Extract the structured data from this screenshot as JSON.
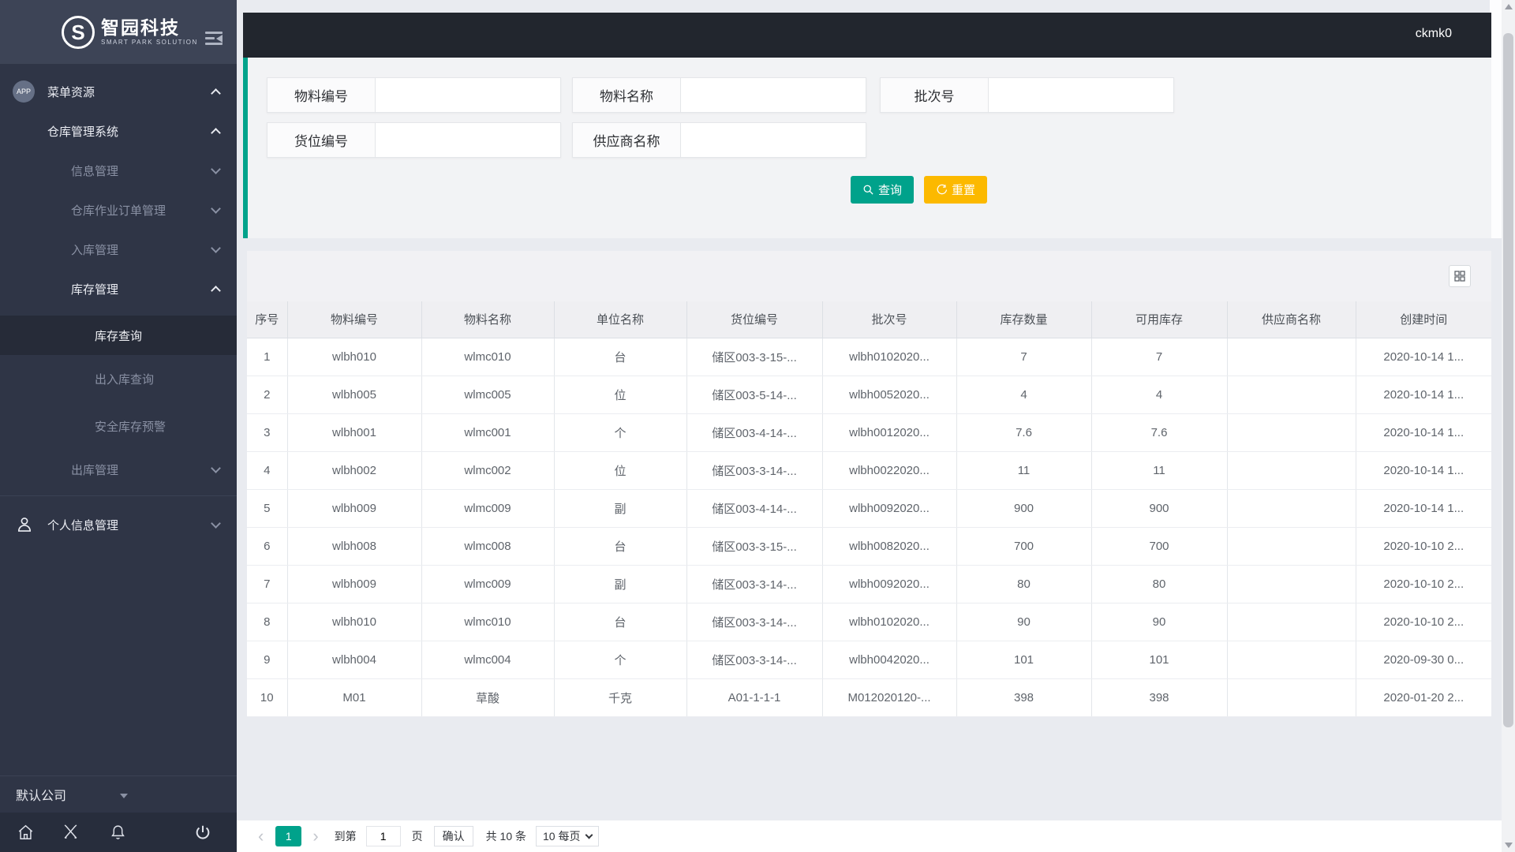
{
  "sidebar": {
    "logo": {
      "icon": "S",
      "title": "智园科技",
      "subtitle": "SMART PARK SOLUTION"
    },
    "menu": [
      {
        "key": "menu-resources",
        "label": "菜单资源",
        "level": 1,
        "tone": "white",
        "chevron": "up",
        "badge": "APP"
      },
      {
        "key": "warehouse-system",
        "label": "仓库管理系统",
        "level": 2,
        "tone": "white",
        "chevron": "up"
      },
      {
        "key": "info-mgmt",
        "label": "信息管理",
        "level": 3,
        "tone": "gray",
        "chevron": "down"
      },
      {
        "key": "warehouse-order-mgmt",
        "label": "仓库作业订单管理",
        "level": 3,
        "tone": "gray",
        "chevron": "down"
      },
      {
        "key": "inbound-mgmt",
        "label": "入库管理",
        "level": 3,
        "tone": "gray",
        "chevron": "down"
      },
      {
        "key": "inventory-mgmt",
        "label": "库存管理",
        "level": 3,
        "tone": "white",
        "chevron": "up"
      },
      {
        "key": "inventory-query",
        "label": "库存查询",
        "level": 4,
        "tone": "white",
        "active": true
      },
      {
        "key": "inout-query",
        "label": "出入库查询",
        "level": 4,
        "tone": "gray"
      },
      {
        "key": "safety-stock-alert",
        "label": "安全库存预警",
        "level": 4,
        "tone": "gray"
      },
      {
        "key": "outbound-mgmt",
        "label": "出库管理",
        "level": 3,
        "tone": "gray",
        "chevron": "down"
      },
      {
        "divider": true
      },
      {
        "key": "personal-info-mgmt",
        "label": "个人信息管理",
        "level": 1,
        "tone": "white",
        "chevron": "down",
        "icon": "user"
      }
    ],
    "company": "默认公司"
  },
  "header": {
    "username": "ckmk0"
  },
  "search": {
    "fields": [
      {
        "key": "material-code",
        "label": "物料编号",
        "value": "",
        "pos": "r1c1"
      },
      {
        "key": "material-name",
        "label": "物料名称",
        "value": "",
        "pos": "r1c2"
      },
      {
        "key": "batch-no",
        "label": "批次号",
        "value": "",
        "pos": "r1c3"
      },
      {
        "key": "location-code",
        "label": "货位编号",
        "value": "",
        "pos": "r2c1"
      },
      {
        "key": "supplier-name",
        "label": "供应商名称",
        "value": "",
        "pos": "r2c2"
      }
    ],
    "query_label": "查询",
    "reset_label": "重置"
  },
  "table": {
    "columns": [
      "序号",
      "物料编号",
      "物料名称",
      "单位名称",
      "货位编号",
      "批次号",
      "库存数量",
      "可用库存",
      "供应商名称",
      "创建时间"
    ],
    "rows": [
      [
        "1",
        "wlbh010",
        "wlmc010",
        "台",
        "储区003-3-15-...",
        "wlbh0102020...",
        "7",
        "7",
        "",
        "2020-10-14 1..."
      ],
      [
        "2",
        "wlbh005",
        "wlmc005",
        "位",
        "储区003-5-14-...",
        "wlbh0052020...",
        "4",
        "4",
        "",
        "2020-10-14 1..."
      ],
      [
        "3",
        "wlbh001",
        "wlmc001",
        "个",
        "储区003-4-14-...",
        "wlbh0012020...",
        "7.6",
        "7.6",
        "",
        "2020-10-14 1..."
      ],
      [
        "4",
        "wlbh002",
        "wlmc002",
        "位",
        "储区003-3-14-...",
        "wlbh0022020...",
        "11",
        "11",
        "",
        "2020-10-14 1..."
      ],
      [
        "5",
        "wlbh009",
        "wlmc009",
        "副",
        "储区003-4-14-...",
        "wlbh0092020...",
        "900",
        "900",
        "",
        "2020-10-14 1..."
      ],
      [
        "6",
        "wlbh008",
        "wlmc008",
        "台",
        "储区003-3-15-...",
        "wlbh0082020...",
        "700",
        "700",
        "",
        "2020-10-10 2..."
      ],
      [
        "7",
        "wlbh009",
        "wlmc009",
        "副",
        "储区003-3-14-...",
        "wlbh0092020...",
        "80",
        "80",
        "",
        "2020-10-10 2..."
      ],
      [
        "8",
        "wlbh010",
        "wlmc010",
        "台",
        "储区003-3-14-...",
        "wlbh0102020...",
        "90",
        "90",
        "",
        "2020-10-10 2..."
      ],
      [
        "9",
        "wlbh004",
        "wlmc004",
        "个",
        "储区003-3-14-...",
        "wlbh0042020...",
        "101",
        "101",
        "",
        "2020-09-30 0..."
      ],
      [
        "10",
        "M01",
        "草酸",
        "千克",
        "A01-1-1-1",
        "M012020120-...",
        "398",
        "398",
        "",
        "2020-01-20 2..."
      ]
    ]
  },
  "pagination": {
    "prev": "‹",
    "page": "1",
    "next": "›",
    "goto_prefix": "到第",
    "goto_value": "1",
    "goto_suffix": "页",
    "confirm_label": "确认",
    "total_label": "共 10 条",
    "page_size_label": "10 每页"
  },
  "colors": {
    "accent_teal": "#00a28b",
    "accent_yellow": "#fcb900",
    "header_dark": "#22262e",
    "sidebar_dark": "#2f3546"
  }
}
